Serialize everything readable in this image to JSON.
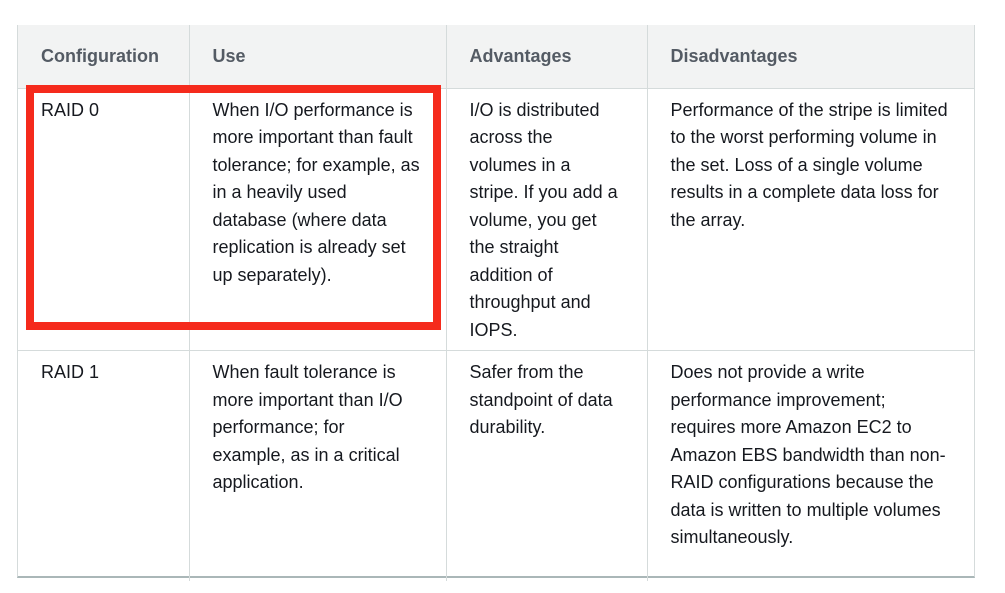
{
  "table": {
    "headers": [
      "Configuration",
      "Use",
      "Advantages",
      "Disadvantages"
    ],
    "rows": [
      {
        "configuration": "RAID 0",
        "use": "When I/O performance is more important than fault tolerance; for example, as in a heavily used database (where data replication is already set up separately).",
        "advantages": "I/O is distributed across the volumes in a stripe. If you add a volume, you get the straight addition of throughput and IOPS.",
        "disadvantages": "Performance of the stripe is limited to the worst performing volume in the set. Loss of a single volume results in a complete data loss for the array."
      },
      {
        "configuration": "RAID 1",
        "use": "When fault tolerance is more important than I/O performance; for example, as in a critical application.",
        "advantages": "Safer from the standpoint of data durability.",
        "disadvantages": "Does not provide a write performance improvement; requires more Amazon EC2 to Amazon EBS bandwidth than non-RAID configurations because the data is written to multiple volumes simultaneously."
      }
    ]
  },
  "annotation": {
    "color": "#f52a1c"
  }
}
